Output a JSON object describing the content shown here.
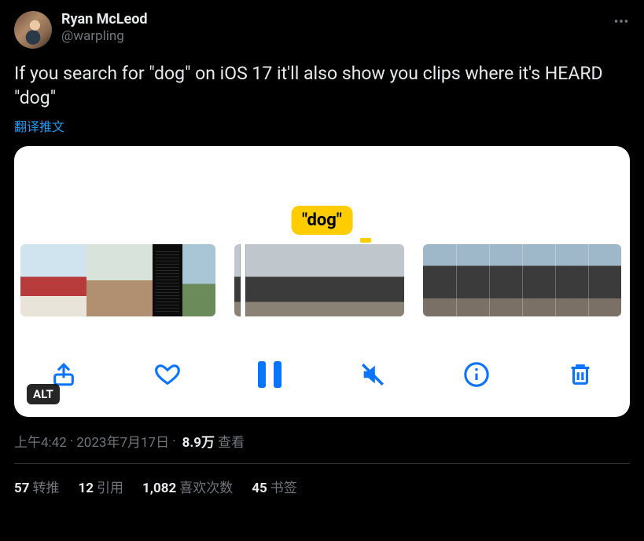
{
  "author": {
    "display_name": "Ryan McLeod",
    "handle": "@warpling"
  },
  "tweet_text": "If you search for \"dog\" on iOS 17 it'll also show you clips where it's HEARD \"dog\"",
  "translate_label": "翻译推文",
  "media": {
    "search_bubble": "\"dog\"",
    "alt_badge": "ALT"
  },
  "timestamp": {
    "time": "上午4:42",
    "date": "2023年7月17日"
  },
  "views": {
    "count": "8.9万",
    "label": "查看"
  },
  "stats": {
    "retweets": {
      "count": "57",
      "label": "转推"
    },
    "quotes": {
      "count": "12",
      "label": "引用"
    },
    "likes": {
      "count": "1,082",
      "label": "喜欢次数"
    },
    "bookmarks": {
      "count": "45",
      "label": "书签"
    }
  },
  "icons": {
    "more": "more-icon",
    "share": "share-icon",
    "like": "heart-icon",
    "pause": "pause-icon",
    "mute": "mute-icon",
    "info": "info-icon",
    "trash": "trash-icon"
  }
}
